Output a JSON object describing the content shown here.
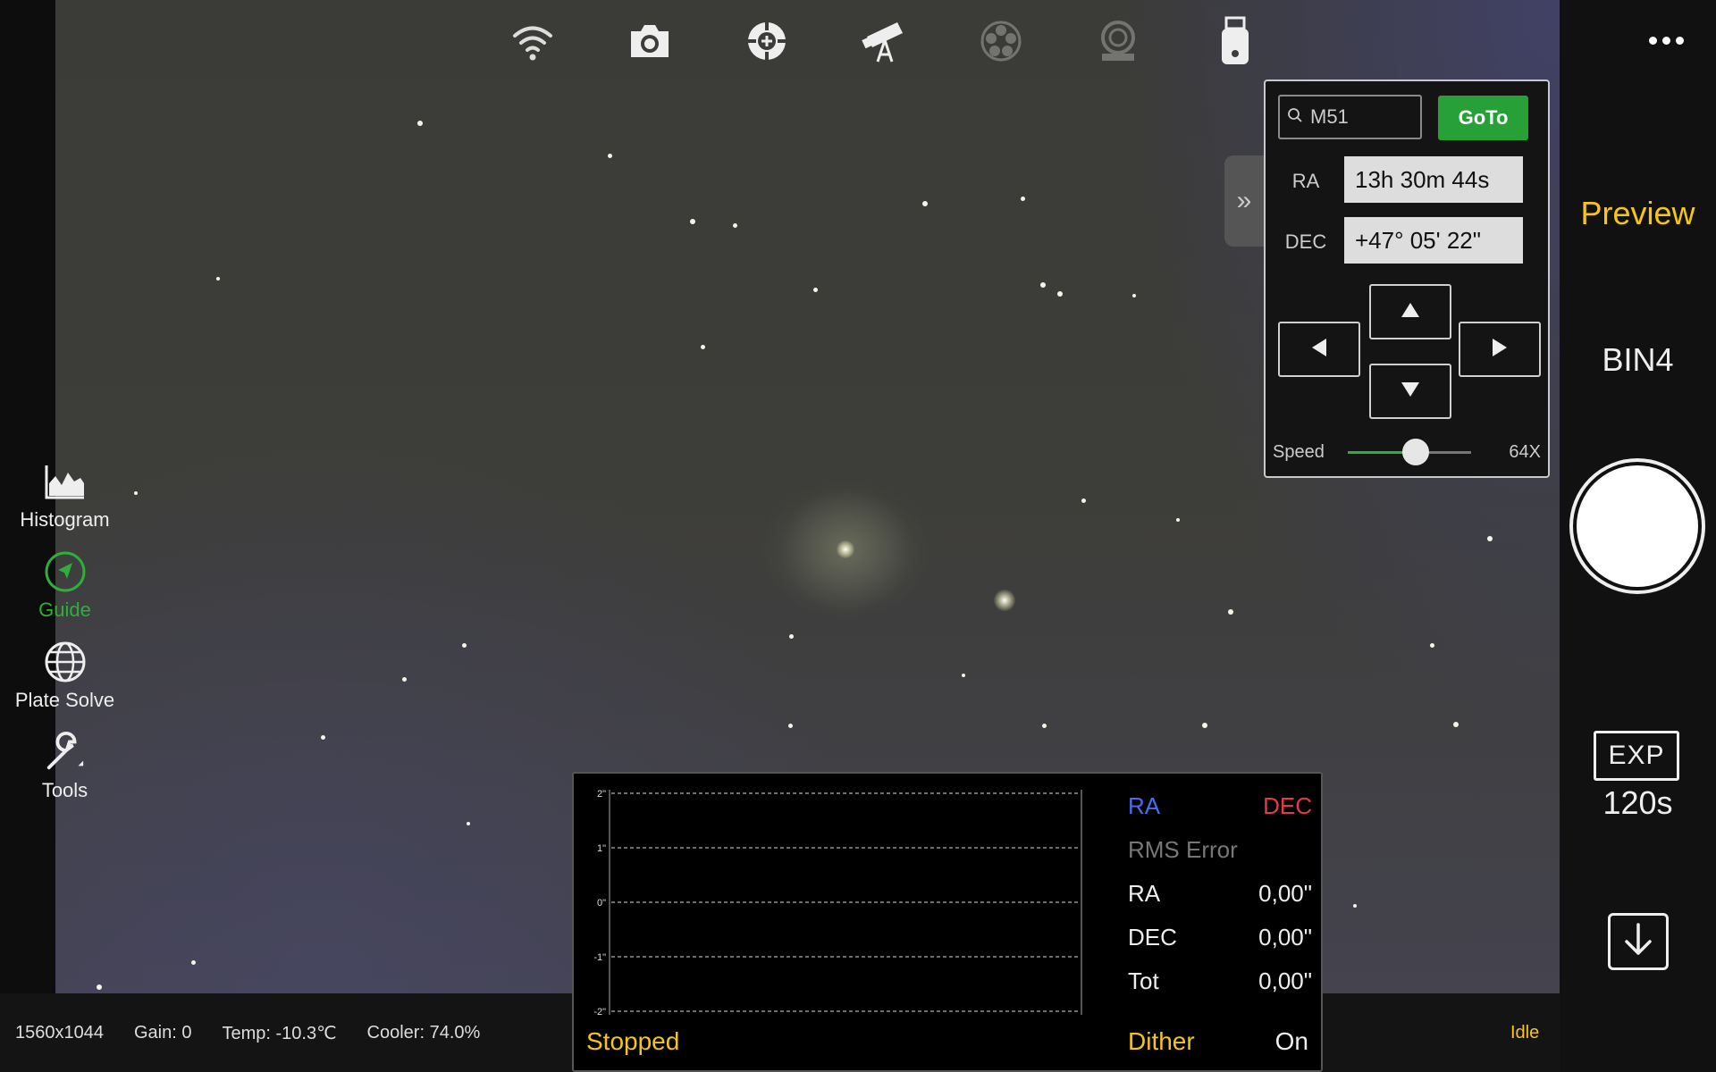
{
  "toolbar": {
    "icons": [
      "wifi-icon",
      "camera-icon",
      "guide-scope-icon",
      "telescope-icon",
      "filter-wheel-icon",
      "focuser-icon",
      "usb-storage-icon"
    ]
  },
  "left_tools": [
    {
      "label": "Histogram",
      "icon": "histogram-icon",
      "active": false
    },
    {
      "label": "Guide",
      "icon": "guide-icon",
      "active": true
    },
    {
      "label": "Plate Solve",
      "icon": "globe-icon",
      "active": false
    },
    {
      "label": "Tools",
      "icon": "wrench-icon",
      "active": false
    }
  ],
  "capture": {
    "mode": "Preview",
    "bin": "BIN4",
    "exp_label": "EXP",
    "exp_value": "120s"
  },
  "status": {
    "resolution": "1560x1044",
    "gain": "Gain: 0",
    "temp": "Temp: -10.3℃",
    "cooler": "Cooler: 74.0%",
    "state": "Idle"
  },
  "mount": {
    "search_value": "M51",
    "goto_label": "GoTo",
    "ra_label": "RA",
    "ra_value": "13h 30m 44s",
    "dec_label": "DEC",
    "dec_value": "+47° 05' 22\"",
    "speed_label": "Speed",
    "speed_value": "64X",
    "speed_fraction": 0.55,
    "collapse_glyph": "»"
  },
  "guide": {
    "chart_data": {
      "type": "line",
      "yticks": [
        "2\"",
        "1\"",
        "0\"",
        "-1\"",
        "-2\""
      ],
      "ylim": [
        -2,
        2
      ],
      "series": []
    },
    "legend_ra": "RA",
    "legend_dec": "DEC",
    "rms_title": "RMS Error",
    "rms": [
      {
        "label": "RA",
        "value": "0,00\""
      },
      {
        "label": "DEC",
        "value": "0,00\""
      },
      {
        "label": "Tot",
        "value": "0,00\""
      }
    ],
    "state": "Stopped",
    "dither_label": "Dither",
    "dither_value": "On"
  },
  "colors": {
    "accent_green": "#27a037",
    "accent_yellow": "#f5c518",
    "ra_blue": "#4a6cf0",
    "dec_red": "#e33a4a"
  }
}
